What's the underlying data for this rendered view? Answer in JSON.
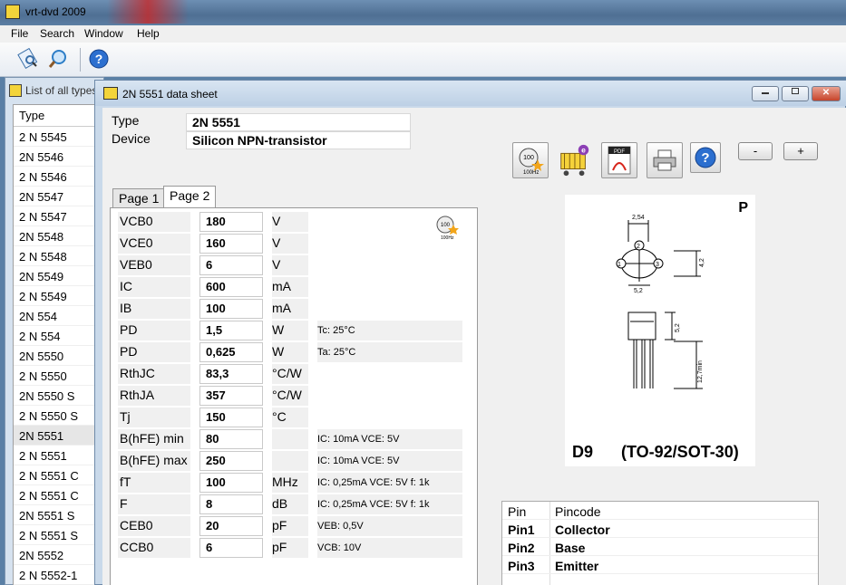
{
  "app": {
    "title": "vrt-dvd 2009"
  },
  "menu": {
    "file": "File",
    "search": "Search",
    "window": "Window",
    "help": "Help"
  },
  "list_window": {
    "title": "List of all types",
    "header": "Type",
    "items": [
      "2 N 5545",
      "2N 5546",
      "2 N 5546",
      "2N 5547",
      "2 N 5547",
      "2N 5548",
      "2 N 5548",
      "2N 5549",
      "2 N 5549",
      "2N 554",
      "2 N 554",
      "2N 5550",
      "2 N 5550",
      "2N 5550 S",
      "2 N 5550 S",
      "2N 5551",
      "2 N 5551",
      "2 N 5551 C",
      "2 N 5551 C",
      "2N 5551 S",
      "2 N 5551 S",
      "2N 5552",
      "2 N 5552-1"
    ]
  },
  "datasheet": {
    "title": "2N 5551 data sheet",
    "type_label": "Type",
    "type_value": "2N 5551",
    "device_label": "Device",
    "device_value": "Silicon NPN-transistor",
    "tabs": [
      "Page 1",
      "Page 2"
    ],
    "zoom_minus": "-",
    "zoom_plus": "+",
    "params": [
      {
        "name": "VCB0",
        "value": "180",
        "unit": "V",
        "cond": ""
      },
      {
        "name": "VCE0",
        "value": "160",
        "unit": "V",
        "cond": ""
      },
      {
        "name": "VEB0",
        "value": "6",
        "unit": "V",
        "cond": ""
      },
      {
        "name": "IC",
        "value": "600",
        "unit": "mA",
        "cond": ""
      },
      {
        "name": "IB",
        "value": "100",
        "unit": "mA",
        "cond": ""
      },
      {
        "name": "PD",
        "value": "1,5",
        "unit": "W",
        "cond": "Tc: 25°C"
      },
      {
        "name": "PD",
        "value": "0,625",
        "unit": "W",
        "cond": "Ta: 25°C"
      },
      {
        "name": "RthJC",
        "value": "83,3",
        "unit": "°C/W",
        "cond": ""
      },
      {
        "name": "RthJA",
        "value": "357",
        "unit": "°C/W",
        "cond": ""
      },
      {
        "name": "Tj",
        "value": "150",
        "unit": "°C",
        "cond": ""
      },
      {
        "name": "B(hFE) min",
        "value": "80",
        "unit": "",
        "cond": "IC: 10mA VCE: 5V"
      },
      {
        "name": "B(hFE) max",
        "value": "250",
        "unit": "",
        "cond": "IC: 10mA VCE: 5V"
      },
      {
        "name": "fT",
        "value": "100",
        "unit": "MHz",
        "cond": "IC: 0,25mA VCE: 5V f: 1k"
      },
      {
        "name": "F",
        "value": "8",
        "unit": "dB",
        "cond": "IC: 0,25mA VCE: 5V f: 1k"
      },
      {
        "name": "CEB0",
        "value": "20",
        "unit": "pF",
        "cond": "VEB: 0,5V"
      },
      {
        "name": "CCB0",
        "value": "6",
        "unit": "pF",
        "cond": "VCB: 10V"
      }
    ],
    "package": {
      "letter": "P",
      "code": "D9",
      "name": "(TO-92/SOT-30)",
      "dim_pitch": "2,54",
      "dim_w": "5,2",
      "dim_h": "4,2",
      "dim_body": "5,2",
      "dim_lead": "12,7min"
    },
    "pins": {
      "header_pin": "Pin",
      "header_code": "Pincode",
      "rows": [
        {
          "pin": "Pin1",
          "code": "Collector"
        },
        {
          "pin": "Pin2",
          "code": "Base"
        },
        {
          "pin": "Pin3",
          "code": "Emitter"
        }
      ]
    },
    "icon_label_100": "100",
    "icon_label_hz": "100Hz",
    "pdf_label": "PDF"
  }
}
